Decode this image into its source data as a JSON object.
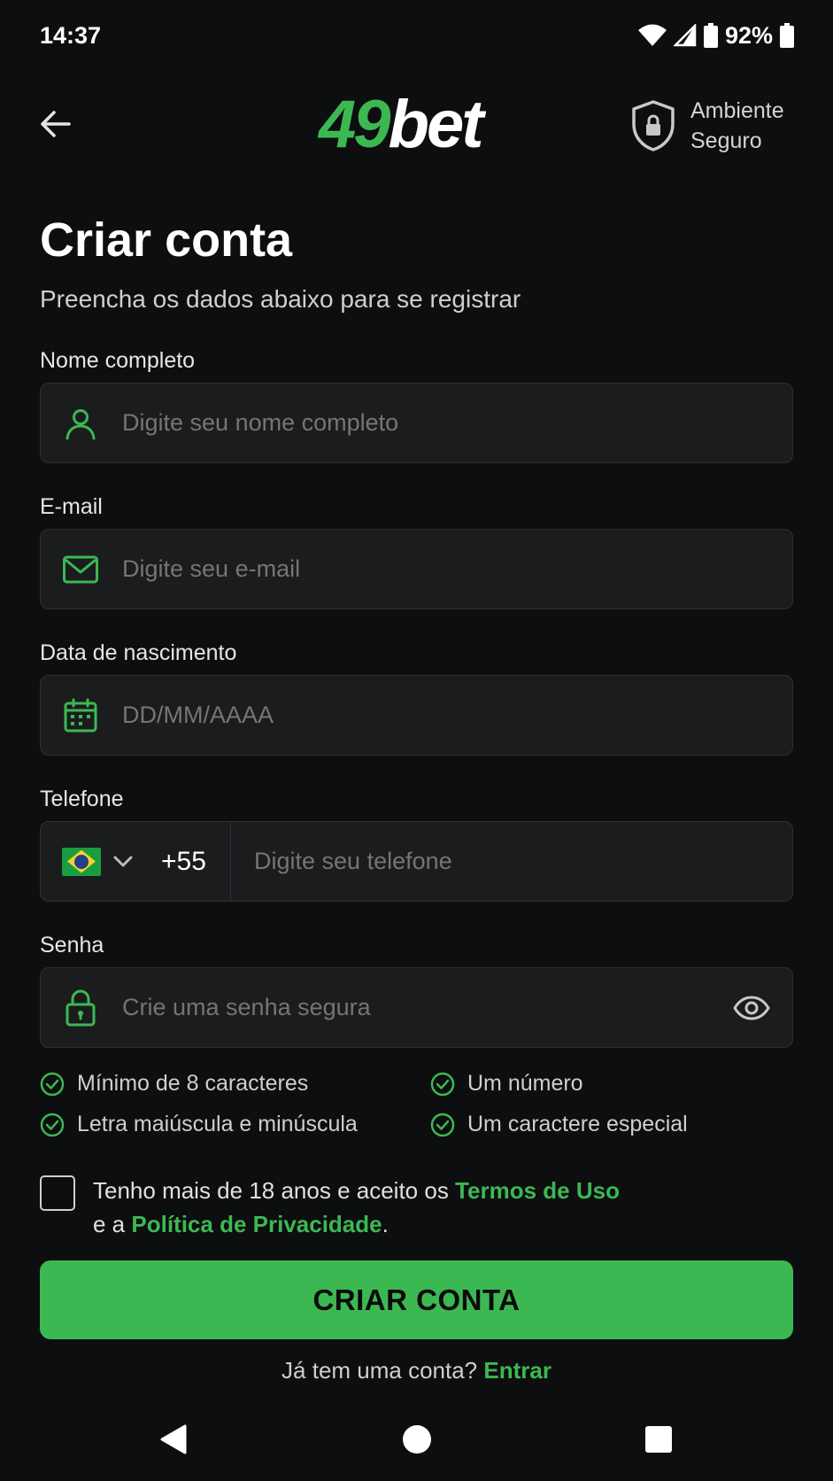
{
  "status_bar": {
    "time": "14:37",
    "battery": "92%"
  },
  "header": {
    "logo_part1": "49",
    "logo_part2": "bet",
    "secure_line1": "Ambiente",
    "secure_line2": "Seguro"
  },
  "page": {
    "title": "Criar conta",
    "subtitle": "Preencha os dados abaixo para se registrar"
  },
  "form": {
    "name": {
      "label": "Nome completo",
      "placeholder": "Digite seu nome completo"
    },
    "email": {
      "label": "E-mail",
      "placeholder": "Digite seu e-mail"
    },
    "birthdate": {
      "label": "Data de nascimento",
      "placeholder": "DD/MM/AAAA"
    },
    "phone": {
      "label": "Telefone",
      "country_code": "+55",
      "placeholder": "Digite seu telefone"
    },
    "password": {
      "label": "Senha",
      "placeholder": "Crie uma senha segura"
    }
  },
  "requirements": [
    "Mínimo de 8 caracteres",
    "Um número",
    "Letra maiúscula e minúscula",
    "Um caractere especial"
  ],
  "terms": {
    "text1": "Tenho mais de 18 anos e aceito os ",
    "terms_link": "Termos de Uso",
    "text2": "e a ",
    "privacy_link": "Política de Privacidade",
    "text3": "."
  },
  "cta": {
    "label": "CRIAR CONTA"
  },
  "login": {
    "prompt": "Já tem uma conta? ",
    "link": "Entrar"
  },
  "colors": {
    "accent": "#3cb853",
    "background": "#0d0e0f",
    "field_bg": "#1b1c1e"
  }
}
